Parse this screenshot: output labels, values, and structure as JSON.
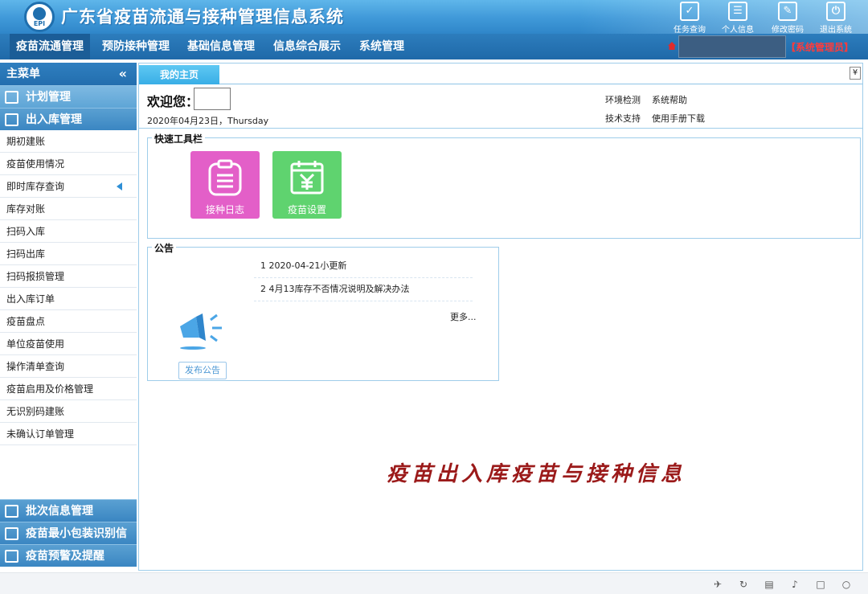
{
  "app": {
    "title": "广东省疫苗流通与接种管理信息系统",
    "logo_text": "EPI"
  },
  "top_tools": [
    {
      "label": "任务查询",
      "icon": "task-check-icon",
      "glyph": "✓"
    },
    {
      "label": "个人信息",
      "icon": "user-card-icon",
      "glyph": "☰"
    },
    {
      "label": "修改密码",
      "icon": "edit-password-icon",
      "glyph": "✎"
    },
    {
      "label": "退出系统",
      "icon": "power-icon",
      "glyph": "⏻"
    }
  ],
  "nav": {
    "items": [
      "疫苗流通管理",
      "预防接种管理",
      "基础信息管理",
      "信息综合展示",
      "系统管理"
    ],
    "active_index": 0,
    "role": "【系统管理员】"
  },
  "sidebar": {
    "title": "主菜单",
    "collapse_glyph": "«",
    "sections_top": [
      "计划管理",
      "出入库管理"
    ],
    "items": [
      "期初建账",
      "疫苗使用情况",
      "即时库存查询",
      "库存对账",
      "扫码入库",
      "扫码出库",
      "扫码报损管理",
      "出入库订单",
      "疫苗盘点",
      "单位疫苗使用",
      "操作清单查询",
      "疫苗启用及价格管理",
      "无识别码建账",
      "未确认订单管理"
    ],
    "selected_index": 2,
    "sections_bottom": [
      "批次信息管理",
      "疫苗最小包装识别信息",
      "疫苗预警及提醒"
    ]
  },
  "tabs": {
    "current": "我的主页",
    "more_glyph": "¥"
  },
  "welcome": {
    "greeting": "欢迎您：",
    "date": "2020年04月23日，Thursday",
    "links": [
      {
        "label": "环境检测",
        "value": "系统帮助"
      },
      {
        "label": "技术支持",
        "value": "使用手册下载"
      }
    ]
  },
  "quick_toolbar": {
    "title": "快速工具栏",
    "buttons": [
      {
        "label": "接种日志",
        "color": "#e35fc8",
        "icon": "clipboard-log-icon"
      },
      {
        "label": "疫苗设置",
        "color": "#5fd36f",
        "icon": "calendar-yen-icon"
      }
    ]
  },
  "notice": {
    "title": "公告",
    "items": [
      "1  2020-04-21小更新",
      "2  4月13库存不否情况说明及解决办法"
    ],
    "more": "更多...",
    "publish": "发布公告"
  },
  "watermark": "疫苗出入库疫苗与接种信息",
  "colors": {
    "header": "#3f98d8",
    "nav": "#1f69a8",
    "accent": "#39aee6",
    "role": "#ff3b3b",
    "watermark": "#9b1a1a"
  }
}
